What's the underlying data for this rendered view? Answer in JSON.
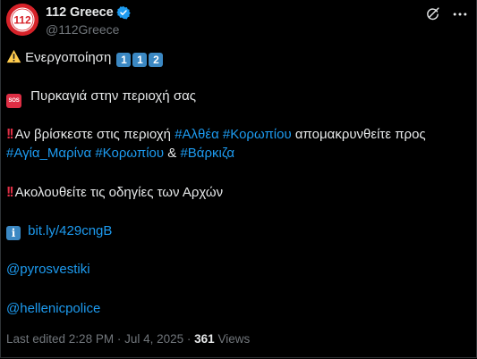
{
  "header": {
    "display_name": "112 Greece",
    "handle": "@112Greece",
    "avatar_text": "112"
  },
  "post": {
    "activation": {
      "text": "Ενεργοποίηση",
      "keycaps": [
        "1",
        "1",
        "2"
      ]
    },
    "fire_line": "Πυρκαγιά στην περιοχή σας",
    "if_line": {
      "prefix": "Αν βρίσκεστε στις περιοχή",
      "tag1": "#Αλθέα",
      "tag2": "#Κορωπίου",
      "suffix": "απομακρυνθείτε προς"
    },
    "dest_line": {
      "tag1": "#Αγία_Μαρίνα",
      "tag2": "#Κορωπίου",
      "amp": "&",
      "tag3": "#Βάρκιζα"
    },
    "follow_line": "Ακολουθείτε τις οδηγίες των Αρχών",
    "link": "bit.ly/429cngB",
    "mention1": "@pyrosvestiki",
    "mention2": "@hellenicpolice"
  },
  "footer": {
    "edited": "Last edited 2:28 PM · Jul 4, 2025 ·",
    "views_count": "361",
    "views_label": "Views"
  }
}
